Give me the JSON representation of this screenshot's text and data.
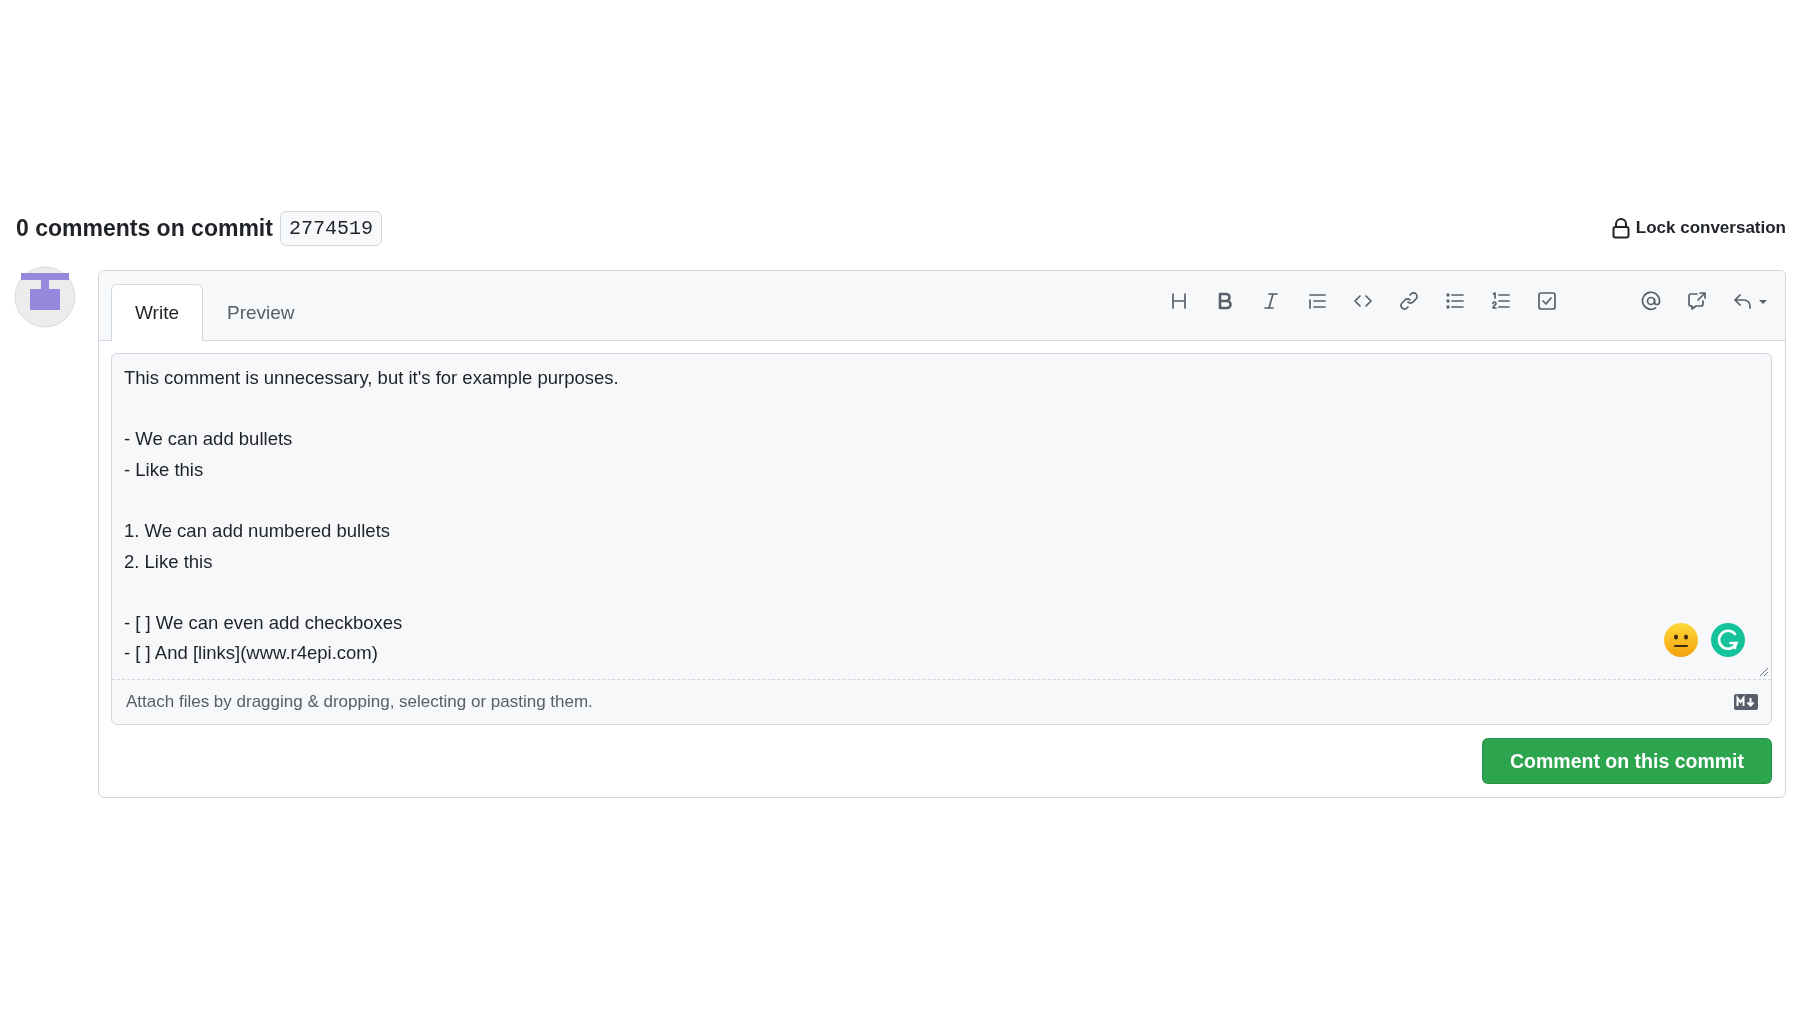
{
  "header": {
    "title": "0 comments on commit",
    "commit": "2774519",
    "lock_action": "Lock conversation"
  },
  "editor": {
    "tabs": [
      {
        "label": "Write",
        "selected": true
      },
      {
        "label": "Preview",
        "selected": false
      }
    ],
    "comment": "This comment is unnecessary, but it's for example purposes.\n\n- We can add bullets\n- Like this\n\n1. We can add numbered bullets\n2. Like this\n\n- [ ] We can even add checkboxes\n- [ ] And [links](www.r4epi.com)",
    "attach_hint": "Attach files by dragging & dropping, selecting or pasting them.",
    "submit": "Comment on this commit"
  }
}
